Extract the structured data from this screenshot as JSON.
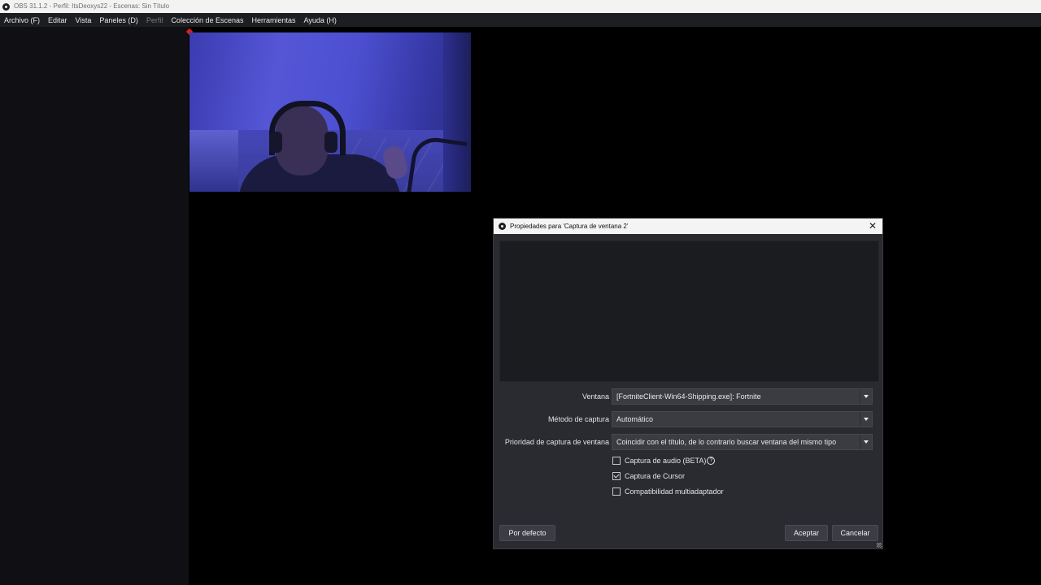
{
  "window": {
    "title": "OBS 31.1.2 - Perfil: ItsDeoxys22 - Escenas: Sin Título",
    "logo_icon": "obs-logo-icon"
  },
  "menubar": {
    "items": [
      {
        "label": "Archivo (F)",
        "enabled": true
      },
      {
        "label": "Editar",
        "enabled": true
      },
      {
        "label": "Vista",
        "enabled": true
      },
      {
        "label": "Paneles (D)",
        "enabled": true
      },
      {
        "label": "Perfil",
        "enabled": false
      },
      {
        "label": "Colección de Escenas",
        "enabled": true
      },
      {
        "label": "Herramientas",
        "enabled": true
      },
      {
        "label": "Ayuda (H)",
        "enabled": true
      }
    ]
  },
  "dialog": {
    "title": "Propiedades para 'Captura de ventana 2'",
    "close_icon": "close-icon",
    "fields": [
      {
        "label": "Ventana",
        "value": "[FortniteClient-Win64-Shipping.exe]: Fortnite"
      },
      {
        "label": "Método de captura",
        "value": "Automático"
      },
      {
        "label": "Prioridad de captura de ventana",
        "value": "Coincidir con el título, de lo contrario buscar ventana del mismo tipo"
      }
    ],
    "checkboxes": [
      {
        "label": "Captura de audio (BETA)",
        "checked": false,
        "help": "?"
      },
      {
        "label": "Captura de Cursor",
        "checked": true
      },
      {
        "label": "Compatibilidad multiadaptador",
        "checked": false
      }
    ],
    "buttons": {
      "defaults": "Por defecto",
      "ok": "Aceptar",
      "cancel": "Cancelar"
    }
  },
  "colors": {
    "accent_marker": "#e21b1b",
    "dialog_bg": "#2a2b30",
    "menubar_bg": "#1d1e22"
  }
}
